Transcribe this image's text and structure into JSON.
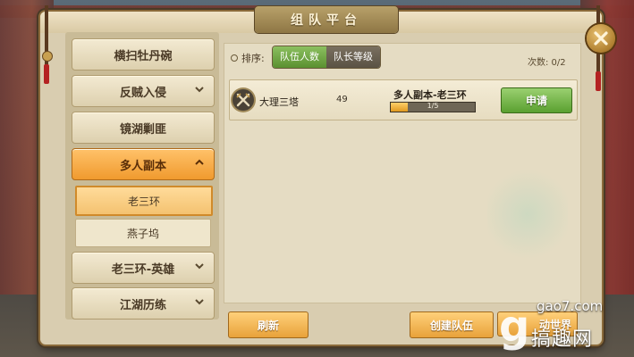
{
  "window": {
    "title": "组队平台"
  },
  "sidebar": {
    "items": [
      {
        "label": "横扫牡丹碗",
        "expandable": false
      },
      {
        "label": "反贼入侵",
        "expandable": true
      },
      {
        "label": "镜湖剿匪",
        "expandable": false
      },
      {
        "label": "多人副本",
        "expandable": true,
        "active": true
      },
      {
        "label": "老三环-英雄",
        "expandable": true
      },
      {
        "label": "江湖历练",
        "expandable": true
      }
    ],
    "subitems": [
      {
        "label": "老三环",
        "selected": true
      },
      {
        "label": "燕子坞",
        "selected": false
      }
    ]
  },
  "sort": {
    "label": "排序:",
    "options": [
      {
        "label": "队伍人数",
        "active": true
      },
      {
        "label": "队长等级",
        "active": false
      }
    ]
  },
  "count_text": "次数: 0/2",
  "teams": [
    {
      "leader": "大理三塔",
      "level": "49",
      "dungeon": "多人副本-老三环",
      "progress_text": "1/5",
      "progress_fraction": 0.2,
      "apply_label": "申请"
    }
  ],
  "footer": {
    "refresh_label": "刷新",
    "create_label": "创建队伍",
    "third_label": "动世界"
  },
  "watermark": {
    "site": "gao7.com",
    "name": "搞趣网"
  },
  "colors": {
    "active_orange": "#f09a2e",
    "apply_green": "#5aa030",
    "panel_bg": "#d9cdb0"
  },
  "icons": {
    "close": "close-x-icon",
    "team": "crossed-swords-icon",
    "chevron": "chevron-down-icon"
  }
}
